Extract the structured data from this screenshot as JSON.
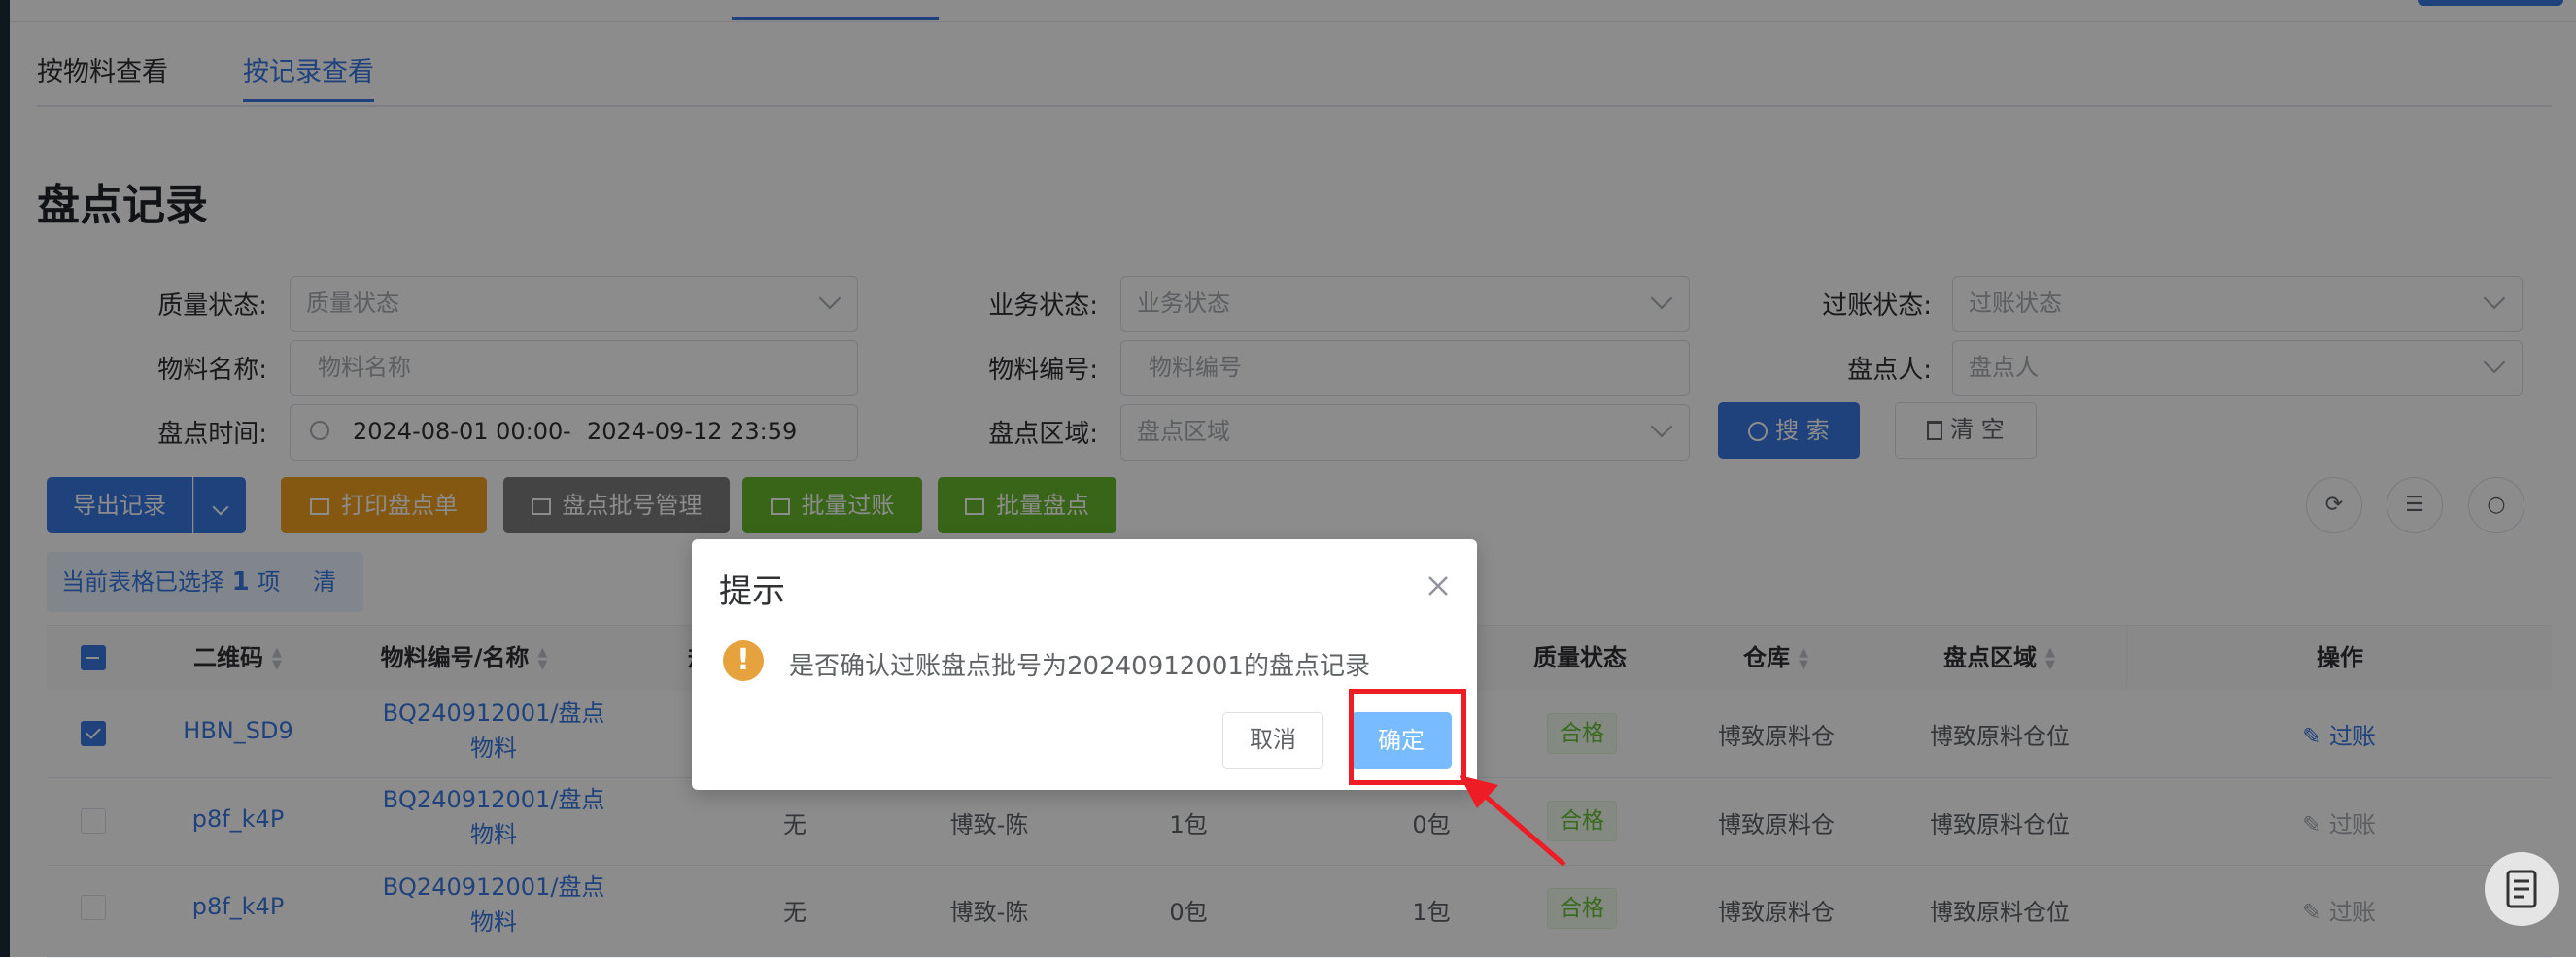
{
  "tabs": [
    {
      "label": "按物料查看"
    },
    {
      "label": "按记录查看"
    }
  ],
  "page_title": "盘点记录",
  "filters": {
    "quality": {
      "label": "质量状态:",
      "placeholder": "质量状态"
    },
    "business": {
      "label": "业务状态:",
      "placeholder": "业务状态"
    },
    "posting": {
      "label": "过账状态:",
      "placeholder": "过账状态"
    },
    "material_name": {
      "label": "物料名称:",
      "placeholder": "物料名称"
    },
    "material_code": {
      "label": "物料编号:",
      "placeholder": "物料编号"
    },
    "counter": {
      "label": "盘点人:",
      "placeholder": "盘点人"
    },
    "time": {
      "label": "盘点时间:",
      "start": "2024-08-01 00:00",
      "sep": "-",
      "end": "2024-09-12 23:59"
    },
    "area": {
      "label": "盘点区域:",
      "placeholder": "盘点区域"
    },
    "search_label": "搜 索",
    "clear_label": "清 空"
  },
  "toolbar": {
    "export_label": "导出记录",
    "print_label": "打印盘点单",
    "batchno_label": "盘点批号管理",
    "batch_post_label": "批量过账",
    "batch_count_label": "批量盘点"
  },
  "selection": {
    "prefix": "当前表格已选择",
    "count": "1",
    "suffix": "项",
    "clear_label": "清 空"
  },
  "table": {
    "headers": {
      "qr": "二维码",
      "material": "物料编号/名称",
      "spec": "规",
      "quality": "质量状态",
      "warehouse": "仓库",
      "area": "盘点区域",
      "action": "操作"
    },
    "rows": [
      {
        "qr": "HBN_SD9",
        "material_l1": "BQ240912001/盘点",
        "material_l2": "物料",
        "spec": "",
        "counter": "",
        "qty": "",
        "count_qty": "",
        "quality": "合格",
        "warehouse": "博致原料仓",
        "area": "博致原料仓位",
        "action": "过账"
      },
      {
        "qr": "p8f_k4P",
        "material_l1": "BQ240912001/盘点",
        "material_l2": "物料",
        "spec": "无",
        "counter": "博致-陈",
        "qty": "1包",
        "count_qty": "0包",
        "quality": "合格",
        "warehouse": "博致原料仓",
        "area": "博致原料仓位",
        "action": "过账"
      },
      {
        "qr": "p8f_k4P",
        "material_l1": "BQ240912001/盘点",
        "material_l2": "物料",
        "spec": "无",
        "counter": "博致-陈",
        "qty": "0包",
        "count_qty": "1包",
        "quality": "合格",
        "warehouse": "博致原料仓",
        "area": "博致原料仓位",
        "action": "过账"
      }
    ]
  },
  "dialog": {
    "title": "提示",
    "message": "是否确认过账盘点批号为20240912001的盘点记录",
    "cancel_label": "取消",
    "confirm_label": "确定"
  },
  "colors": {
    "primary": "#3a78e2",
    "warning": "#e6a23c",
    "success": "#67c23a",
    "annotation": "#ee1c24"
  }
}
